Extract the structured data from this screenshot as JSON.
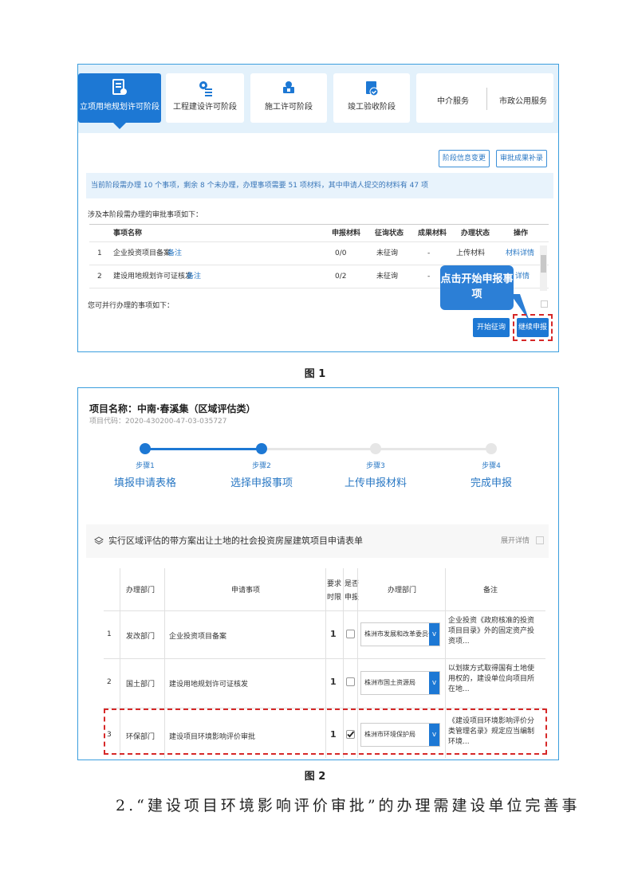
{
  "fig1": {
    "stages": [
      {
        "label": "立项用地规划许可阶段",
        "icon": "document-icon"
      },
      {
        "label": "工程建设许可阶段",
        "icon": "gear-list-icon"
      },
      {
        "label": "施工许可阶段",
        "icon": "construction-icon"
      },
      {
        "label": "竣工验收阶段",
        "icon": "calendar-check-icon"
      }
    ],
    "services": [
      "中介服务",
      "市政公用服务"
    ],
    "btn_stage_change": "阶段信息变更",
    "btn_result_supplement": "审批成果补录",
    "notice": "当前阶段需办理 10 个事项，剩余 8 个未办理，办理事项需要 51 项材料，其中申请人提交的材料有 47 项",
    "section_title": "涉及本阶段需办理的审批事项如下：",
    "columns": [
      "事项名称",
      "申报材料",
      "征询状态",
      "成果材料",
      "办理状态",
      "操作"
    ],
    "rows": [
      {
        "no": "1",
        "name": "企业投资项目备案",
        "note": "备注",
        "materials": "0/0",
        "consult": "未征询",
        "result": "-",
        "status": "上传材料",
        "action": "材料详情"
      },
      {
        "no": "2",
        "name": "建设用地规划许可证核发",
        "note": "备注",
        "materials": "0/2",
        "consult": "未征询",
        "result": "-",
        "status": "",
        "action": "详情"
      }
    ],
    "parallel_title": "您可并行办理的事项如下：",
    "callout": "点击开始申报事项",
    "btn_start_consult": "开始征询",
    "btn_continue": "继续申报"
  },
  "caption1": "图 1",
  "fig2": {
    "project_name": "项目名称：中南·春溪集（区域评估类）",
    "project_code": "项目代码：2020-430200-47-03-035727",
    "steps": [
      {
        "label": "步骤1",
        "name": "填报申请表格",
        "state": "done"
      },
      {
        "label": "步骤2",
        "name": "选择申报事项",
        "state": "current"
      },
      {
        "label": "步骤3",
        "name": "上传申报材料",
        "state": "todo"
      },
      {
        "label": "步骤4",
        "name": "完成申报",
        "state": "todo"
      }
    ],
    "form_title": "实行区域评估的带方案出让土地的社会投资房屋建筑项目申请表单",
    "expand": "展开详情",
    "headers": {
      "dept": "办理部门",
      "item": "申请事项",
      "limit": "要求时限",
      "apply": "是否申报",
      "handler": "办理部门",
      "remark": "备注"
    },
    "rows": [
      {
        "no": "1",
        "dept": "发改部门",
        "item": "企业投资项目备案",
        "limit": "1",
        "checked": false,
        "handler": "株洲市发展和改革委员会",
        "remark": "企业投资《政府核准的投资项目目录》外的固定资产投资项..."
      },
      {
        "no": "2",
        "dept": "国土部门",
        "item": "建设用地规划许可证核发",
        "limit": "1",
        "checked": false,
        "handler": "株洲市国土资源局",
        "remark": "以划拨方式取得国有土地使用权的，建设单位向项目所在地..."
      },
      {
        "no": "3",
        "dept": "环保部门",
        "item": "建设项目环境影响评价审批",
        "limit": "1",
        "checked": true,
        "handler": "株洲市环境保护局",
        "remark": "《建设项目环境影响评价分类管理名录》规定应当编制环境..."
      }
    ]
  },
  "caption2": "图 2",
  "body_text": "2.“建设项目环境影响评价审批”的办理需建设单位完善事",
  "colors": {
    "accent": "#1d78d4",
    "highlight": "#d62828",
    "frame": "#3b9ede"
  }
}
